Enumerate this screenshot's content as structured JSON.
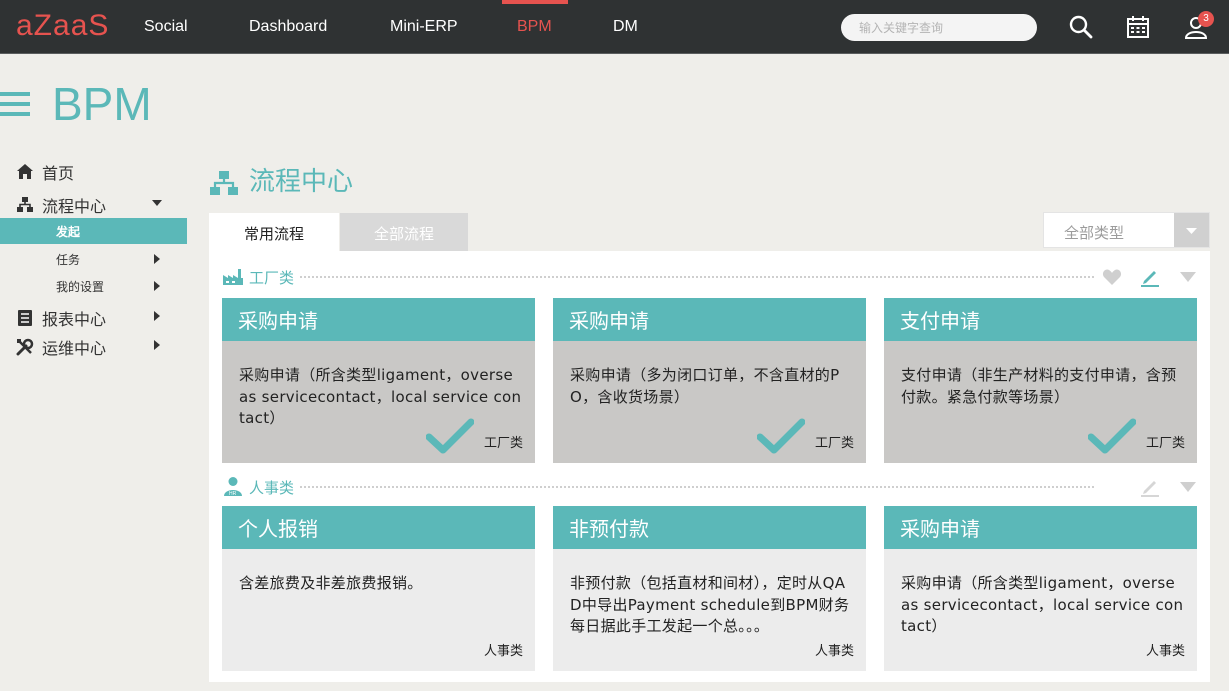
{
  "nav": {
    "logo": "aZaaS",
    "items": [
      "Social",
      "Dashboard",
      "Mini-ERP",
      "BPM",
      "DM"
    ],
    "active": "BPM",
    "search_placeholder": "输入关键字查询",
    "notification_count": "3",
    "accent_color": "#e6534f"
  },
  "page": {
    "title": "BPM",
    "theme_color": "#5bb8b8"
  },
  "sidebar": {
    "items": [
      {
        "label": "首页",
        "icon": "home-icon"
      },
      {
        "label": "流程中心",
        "icon": "sitemap-icon"
      },
      {
        "label": "报表中心",
        "icon": "report-icon"
      },
      {
        "label": "运维中心",
        "icon": "tools-icon"
      }
    ],
    "sub_items": [
      {
        "label": "发起",
        "active": true
      },
      {
        "label": "任务"
      },
      {
        "label": "我的设置"
      }
    ]
  },
  "section": {
    "title": "流程中心",
    "tabs": [
      "常用流程",
      "全部流程"
    ],
    "type_select": "全部类型"
  },
  "groups": [
    {
      "label": "工厂类",
      "cards": [
        {
          "title": "采购申请",
          "desc": "采购申请（所含类型ligament，overse as servicecontact，local service con tact）",
          "tag": "工厂类",
          "checked": true
        },
        {
          "title": "采购申请",
          "desc": "采购申请（多为闭口订单，不含直材的PO，含收货场景）",
          "tag": "工厂类",
          "checked": true
        },
        {
          "title": "支付申请",
          "desc": "支付申请（非生产材料的支付申请，含预付款。紧急付款等场景）",
          "tag": "工厂类",
          "checked": true
        }
      ]
    },
    {
      "label": "人事类",
      "cards": [
        {
          "title": "个人报销",
          "desc": "含差旅费及非差旅费报销。",
          "tag": "人事类",
          "checked": false
        },
        {
          "title": "非预付款",
          "desc": "非预付款（包括直材和间材），定时从QAD中导出Payment schedule到BPM财务每日据此手工发起一个总。。。",
          "tag": "人事类",
          "checked": false
        },
        {
          "title": "采购申请",
          "desc": "采购申请（所含类型ligament，overse as servicecontact，local service con tact）",
          "tag": "人事类",
          "checked": false
        }
      ]
    }
  ]
}
